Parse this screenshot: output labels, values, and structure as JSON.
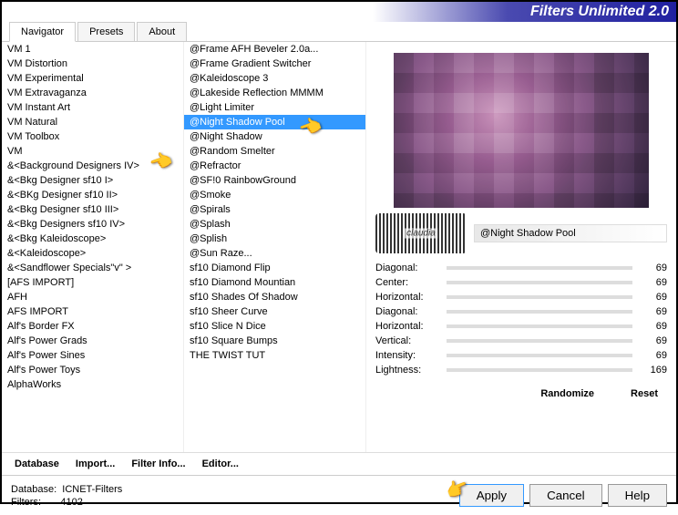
{
  "header": {
    "title": "Filters Unlimited 2.0"
  },
  "tabs": [
    {
      "label": "Navigator",
      "active": true
    },
    {
      "label": "Presets"
    },
    {
      "label": "About"
    }
  ],
  "categories": [
    "VM 1",
    "VM Distortion",
    "VM Experimental",
    "VM Extravaganza",
    "VM Instant Art",
    "VM Natural",
    "VM Toolbox",
    "VM",
    "&<Background Designers IV>",
    "&<Bkg Designer sf10 I>",
    "&<BKg Designer sf10 II>",
    "&<Bkg Designer sf10 III>",
    "&<Bkg Designers sf10 IV>",
    "&<Bkg Kaleidoscope>",
    "&<Kaleidoscope>",
    "&<Sandflower Specials\"v\" >",
    "[AFS IMPORT]",
    "AFH",
    "AFS IMPORT",
    "Alf's Border FX",
    "Alf's Power Grads",
    "Alf's Power Sines",
    "Alf's Power Toys",
    "AlphaWorks"
  ],
  "category_selected_index": 8,
  "filters": [
    "@Frame AFH Beveler 2.0a...",
    "@Frame Gradient Switcher",
    "@Kaleidoscope 3",
    "@Lakeside Reflection MMMM",
    "@Light Limiter",
    "@Night Shadow Pool",
    "@Night Shadow",
    "@Random Smelter",
    "@Refractor",
    "@SF!0 RainbowGround",
    "@Smoke",
    "@Spirals",
    "@Splash",
    "@Splish",
    "@Sun Raze...",
    "sf10 Diamond Flip",
    "sf10 Diamond Mountian",
    "sf10 Shades Of Shadow",
    "sf10 Sheer Curve",
    "sf10 Slice N Dice",
    "sf10 Square Bumps",
    "THE TWIST TUT"
  ],
  "filter_selected_index": 5,
  "selected_filter_name": "@Night Shadow Pool",
  "params": [
    {
      "label": "Diagonal:",
      "value": 69
    },
    {
      "label": "Center:",
      "value": 69
    },
    {
      "label": "Horizontal:",
      "value": 69
    },
    {
      "label": "Diagonal:",
      "value": 69
    },
    {
      "label": "Horizontal:",
      "value": 69
    },
    {
      "label": "Vertical:",
      "value": 69
    },
    {
      "label": "Intensity:",
      "value": 69
    },
    {
      "label": "Lightness:",
      "value": 169
    }
  ],
  "mid_buttons": {
    "database": "Database",
    "import": "Import...",
    "filter_info": "Filter Info...",
    "editor": "Editor..."
  },
  "right_buttons": {
    "randomize": "Randomize",
    "reset": "Reset"
  },
  "footer": {
    "database_label": "Database:",
    "database_value": "ICNET-Filters",
    "filters_label": "Filters:",
    "filters_value": "4102",
    "apply": "Apply",
    "cancel": "Cancel",
    "help": "Help"
  }
}
